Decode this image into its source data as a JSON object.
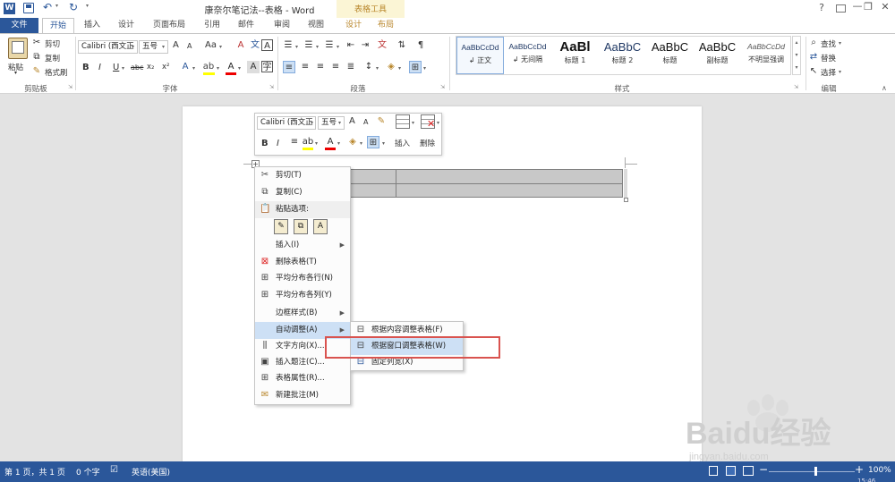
{
  "titlebar": {
    "doc_title": "康奈尔笔记法--表格 - Word",
    "context_title": "表格工具",
    "app_icon": "word-logo-icon",
    "qat_icons": [
      "save-icon",
      "undo-icon",
      "redo-icon"
    ],
    "window_icons": [
      "help-icon",
      "ribbon-display-icon",
      "minimize-icon",
      "restore-icon",
      "close-icon"
    ]
  },
  "tabs": [
    "文件",
    "开始",
    "插入",
    "设计",
    "页面布局",
    "引用",
    "邮件",
    "审阅",
    "视图",
    "设计",
    "布局"
  ],
  "ribbon": {
    "clipboard": {
      "paste": "粘贴",
      "cut": "剪切",
      "copy": "复制",
      "format_painter": "格式刷",
      "label": "剪贴板"
    },
    "font": {
      "name": "Calibri (西文正",
      "size": "五号",
      "grow": "A",
      "shrink": "A",
      "case": "Aa",
      "bold": "B",
      "italic": "I",
      "underline": "U",
      "strike": "abc",
      "subscript": "x₂",
      "superscript": "x²",
      "label": "字体"
    },
    "paragraph": {
      "label": "段落"
    },
    "styles": {
      "items": [
        {
          "sample": "AaBbCcDd",
          "name": "↲ 正文"
        },
        {
          "sample": "AaBbCcDd",
          "name": "↲ 无间隔"
        },
        {
          "sample": "AaBl",
          "name": "标题 1"
        },
        {
          "sample": "AaBbC",
          "name": "标题 2"
        },
        {
          "sample": "AaBbC",
          "name": "标题"
        },
        {
          "sample": "AaBbC",
          "name": "副标题"
        },
        {
          "sample": "AaBbCcDd",
          "name": "不明显强调"
        }
      ],
      "label": "样式"
    },
    "editing": {
      "find": "查找",
      "replace": "替换",
      "select": "选择",
      "label": "编辑"
    }
  },
  "mini_toolbar": {
    "font_name": "Calibri (西文正",
    "font_size": "五号",
    "insert": "插入",
    "delete": "删除"
  },
  "context_menu": {
    "items": [
      {
        "label": "剪切(T)",
        "icon": "scissors-icon"
      },
      {
        "label": "复制(C)",
        "icon": "copy-icon"
      },
      {
        "label": "粘贴选项:",
        "icon": "paste-icon"
      },
      {
        "label": "插入(I)",
        "icon": ""
      },
      {
        "label": "删除表格(T)",
        "icon": "delete-table-icon"
      },
      {
        "label": "平均分布各行(N)",
        "icon": "distribute-rows-icon"
      },
      {
        "label": "平均分布各列(Y)",
        "icon": "distribute-columns-icon"
      },
      {
        "label": "边框样式(B)",
        "icon": ""
      },
      {
        "label": "自动调整(A)",
        "icon": ""
      },
      {
        "label": "文字方向(X)...",
        "icon": "text-direction-icon"
      },
      {
        "label": "插入题注(C)...",
        "icon": "caption-icon"
      },
      {
        "label": "表格属性(R)...",
        "icon": "table-properties-icon"
      },
      {
        "label": "新建批注(M)",
        "icon": "new-comment-icon"
      }
    ]
  },
  "submenu": {
    "items": [
      {
        "label": "根据内容调整表格(F)",
        "icon": "autofit-content-icon"
      },
      {
        "label": "根据窗口调整表格(W)",
        "icon": "autofit-window-icon"
      },
      {
        "label": "固定列宽(X)",
        "icon": "fixed-width-icon"
      }
    ],
    "highlight_color": "#d9534f"
  },
  "statusbar": {
    "page": "第 1 页，共 1 页",
    "words": "0 个字",
    "language": "英语(美国)",
    "zoom": "100%",
    "zoom_minus": "−",
    "zoom_plus": "+",
    "clock": "15:46"
  },
  "watermark": {
    "brand": "Baidu经验",
    "url": "jingyan.baidu.com"
  },
  "colors": {
    "word_blue": "#2b579a",
    "context_band": "#fbf5d5",
    "context_text": "#b8862b",
    "table_fill": "#c8c8c8"
  }
}
